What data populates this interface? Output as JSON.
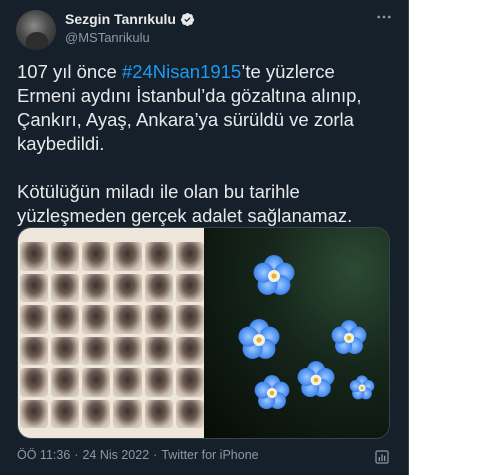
{
  "author": {
    "display_name": "Sezgin Tanrıkulu",
    "handle": "@MSTanrikulu",
    "verified_icon": "verified-badge-icon"
  },
  "tweet": {
    "para1_prefix": "107 yıl önce ",
    "hashtag": "#24Nisan1915",
    "para1_suffix": "’te yüzlerce Ermeni aydını İstanbul’da gözaltına alınıp, Çankırı, Ayaş, Ankara’ya sürüldü ve zorla kaybedildi.",
    "para2": "Kötülüğün miladı ile olan bu tarihle yüzleşmeden gerçek adalet sağlanamaz."
  },
  "footer": {
    "time": "ÖÖ 11:36",
    "sep1": "·",
    "date": "24 Nis 2022",
    "sep2": "·",
    "source": "Twitter for iPhone"
  },
  "icons": {
    "more": "more-options-icon",
    "analytics": "analytics-icon"
  },
  "colors": {
    "background": "#15202b",
    "text": "#e7e9ea",
    "secondary": "#8b98a5",
    "accent": "#1d9bf0"
  }
}
